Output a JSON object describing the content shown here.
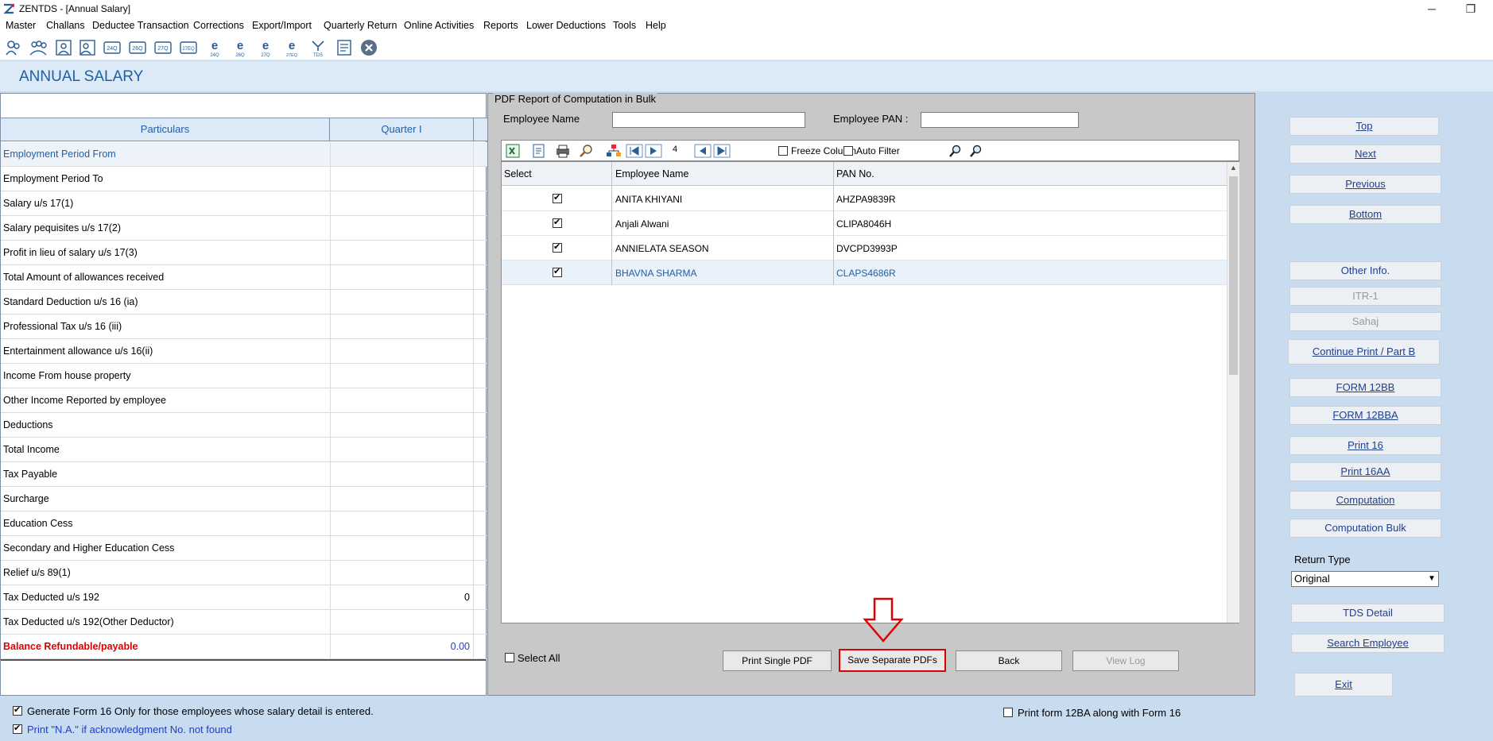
{
  "window": {
    "title": "ZENTDS - [Annual Salary]",
    "minimize_glyph": "─",
    "restore_glyph": "❐"
  },
  "menu": [
    "Master",
    "Challans",
    "Deductee Transaction",
    "Corrections",
    "Export/Import",
    "Quarterly Return",
    "Online Activities",
    "Reports",
    "Lower Deductions",
    "Tools",
    "Help"
  ],
  "toolbar_icons": [
    "deductor-icon",
    "deductees-icon",
    "employee-icon",
    "employee-add-icon",
    "form-24q-icon",
    "form-26q-icon",
    "form-27q-icon",
    "form-27eq-icon",
    "e-24q-icon",
    "e-26q-icon",
    "e-27q-icon",
    "e-27eq-icon",
    "tds-icon",
    "form-icon",
    "close-icon"
  ],
  "page": {
    "title": "ANNUAL SALARY"
  },
  "left_table": {
    "headers": [
      "Particulars",
      "Quarter I"
    ],
    "rows": [
      {
        "label": "Employment Period From",
        "value": ""
      },
      {
        "label": "Employment Period To",
        "value": ""
      },
      {
        "label": "Salary u/s 17(1)",
        "value": ""
      },
      {
        "label": "Salary pequisites u/s 17(2)",
        "value": ""
      },
      {
        "label": "Profit in lieu of salary u/s 17(3)",
        "value": ""
      },
      {
        "label": "Total Amount of allowances received",
        "value": ""
      },
      {
        "label": "Standard Deduction u/s 16 (ia)",
        "value": ""
      },
      {
        "label": "Professional Tax u/s 16 (iii)",
        "value": ""
      },
      {
        "label": "Entertainment allowance u/s 16(ii)",
        "value": ""
      },
      {
        "label": "Income From house property",
        "value": ""
      },
      {
        "label": "Other Income Reported by employee",
        "value": ""
      },
      {
        "label": "Deductions",
        "value": ""
      },
      {
        "label": "Total Income",
        "value": ""
      },
      {
        "label": "Tax Payable",
        "value": ""
      },
      {
        "label": "Surcharge",
        "value": ""
      },
      {
        "label": "Education Cess",
        "value": ""
      },
      {
        "label": "Secondary and Higher Education Cess",
        "value": ""
      },
      {
        "label": "Relief u/s 89(1)",
        "value": ""
      },
      {
        "label": "Tax Deducted u/s 192",
        "value": "0"
      },
      {
        "label": "Tax Deducted u/s 192(Other Deductor)",
        "value": ""
      },
      {
        "label": "Balance Refundable/payable",
        "value": "0.00"
      }
    ]
  },
  "bulk": {
    "group_title": "PDF Report of Computation in Bulk",
    "employee_name_label": "Employee Name",
    "employee_name_value": "",
    "employee_pan_label": "Employee PAN :",
    "employee_pan_value": "",
    "record_count": "4",
    "freeze_column_label": "Freeze Column",
    "auto_filter_label": "Auto Filter",
    "grid_headers": [
      "Select",
      "Employee Name",
      "PAN No."
    ],
    "grid_rows": [
      {
        "selected": true,
        "name": "ANITA KHIYANI",
        "pan": "AHZPA9839R"
      },
      {
        "selected": true,
        "name": "Anjali Alwani",
        "pan": "CLIPA8046H"
      },
      {
        "selected": true,
        "name": "ANNIELATA SEASON",
        "pan": "DVCPD3993P"
      },
      {
        "selected": true,
        "name": "BHAVNA SHARMA",
        "pan": "CLAPS4686R"
      }
    ],
    "select_all_label": "Select All",
    "buttons": {
      "print_single": "Print Single PDF",
      "save_separate": "Save Separate PDFs",
      "back": "Back",
      "view_log": "View Log"
    }
  },
  "right_panel": {
    "top": "Top",
    "next": "Next",
    "previous": "Previous",
    "bottom": "Bottom",
    "other_info": "Other Info.",
    "itr1": "ITR-1",
    "sahaj": "Sahaj",
    "continue_print": "Continue Print / Part B",
    "form12bb": "FORM 12BB",
    "form12bba": "FORM 12BBA",
    "print16": "Print 16",
    "print16aa": "Print 16AA",
    "computation": "Computation",
    "computation_bulk": "Computation Bulk",
    "return_type_label": "Return Type",
    "return_type_value": "Original",
    "tds_detail": "TDS Detail",
    "search_employee": "Search Employee",
    "exit": "Exit"
  },
  "footer": {
    "generate_form16": "Generate Form 16 Only for those employees whose salary detail is entered.",
    "print_na": "Print \"N.A.\" if acknowledgment No. not found",
    "print_12ba": "Print form 12BA along with Form 16"
  },
  "colors": {
    "accent_blue": "#1f5fa8",
    "background": "#c9dcef",
    "highlight_red": "#e00000"
  }
}
